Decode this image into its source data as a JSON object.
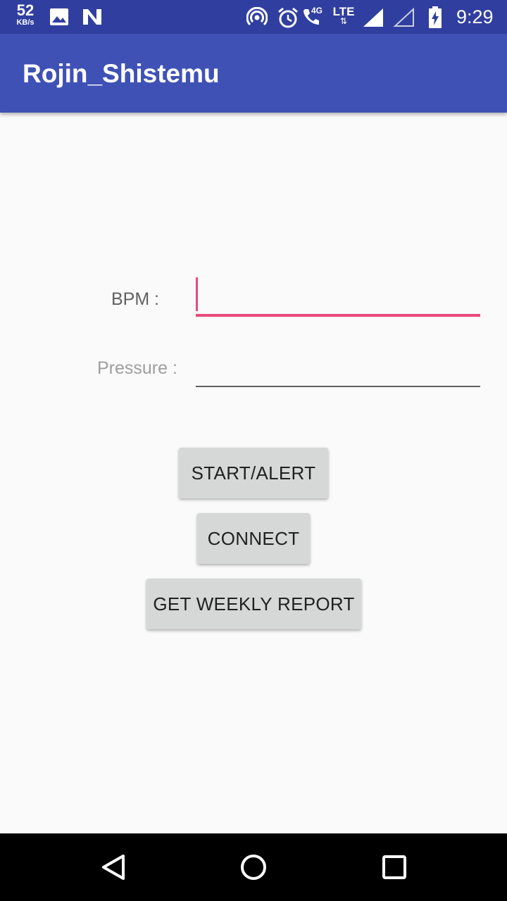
{
  "status_bar": {
    "speed_value": "52",
    "speed_unit": "KB/s",
    "network_4g": "4G",
    "network_lte": "LTE",
    "lte_arrows": "⇅",
    "time": "9:29",
    "icons": [
      "image-icon",
      "n-notification-icon",
      "hotspot-icon",
      "alarm-icon",
      "volte-call-icon",
      "signal-full-icon",
      "signal-empty-icon",
      "battery-charging-icon"
    ]
  },
  "app_bar": {
    "title": "Rojin_Shistemu",
    "color": "#3f51b5"
  },
  "form": {
    "bpm_label": "BPM :",
    "bpm_value": "",
    "pressure_label": "Pressure :",
    "pressure_value": "",
    "accent_color": "#e84a7c"
  },
  "buttons": {
    "start_alert": "START/ALERT",
    "connect": "CONNECT",
    "weekly_report": "GET WEEKLY REPORT"
  },
  "nav_bar": {
    "icons": [
      "back-icon",
      "home-icon",
      "recents-icon"
    ]
  }
}
